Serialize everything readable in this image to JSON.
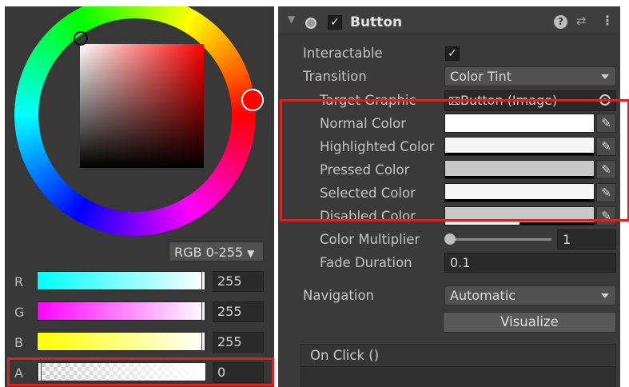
{
  "color_picker": {
    "mode_dropdown": "RGB 0-255",
    "channels": [
      {
        "label": "R",
        "value": "255"
      },
      {
        "label": "G",
        "value": "255"
      },
      {
        "label": "B",
        "value": "255"
      },
      {
        "label": "A",
        "value": "0"
      }
    ],
    "selected_hue_color": "#ff0000"
  },
  "inspector": {
    "component_title": "Button",
    "component_enabled": true,
    "icons": {
      "fold": "fold-arrow-icon",
      "help": "help-icon",
      "presets": "presets-icon",
      "menu": "kebab-menu-icon"
    },
    "help_glyph": "?",
    "rows": {
      "interactable_label": "Interactable",
      "interactable_checked": true,
      "transition_label": "Transition",
      "transition_value": "Color Tint",
      "target_graphic_label": "Target Graphic",
      "target_graphic_value": "Button (Image)",
      "normal_color_label": "Normal Color",
      "highlighted_color_label": "Highlighted Color",
      "pressed_color_label": "Pressed Color",
      "selected_color_label": "Selected Color",
      "disabled_color_label": "Disabled Color",
      "color_multiplier_label": "Color Multiplier",
      "color_multiplier_value": "1",
      "fade_duration_label": "Fade Duration",
      "fade_duration_value": "0.1",
      "navigation_label": "Navigation",
      "navigation_value": "Automatic",
      "visualize_label": "Visualize",
      "on_click_label": "On Click ()"
    },
    "swatches": {
      "normal": "#ffffff",
      "highlighted": "#f5f5f5",
      "pressed": "#c8c8c8",
      "selected": "#f5f5f5",
      "disabled": "#c8c8c8"
    },
    "swatch_alpha": {
      "normal": 1.0,
      "highlighted": 0,
      "pressed": 0,
      "selected": 0,
      "disabled": 0.5
    }
  },
  "highlight_color": "#d42626"
}
